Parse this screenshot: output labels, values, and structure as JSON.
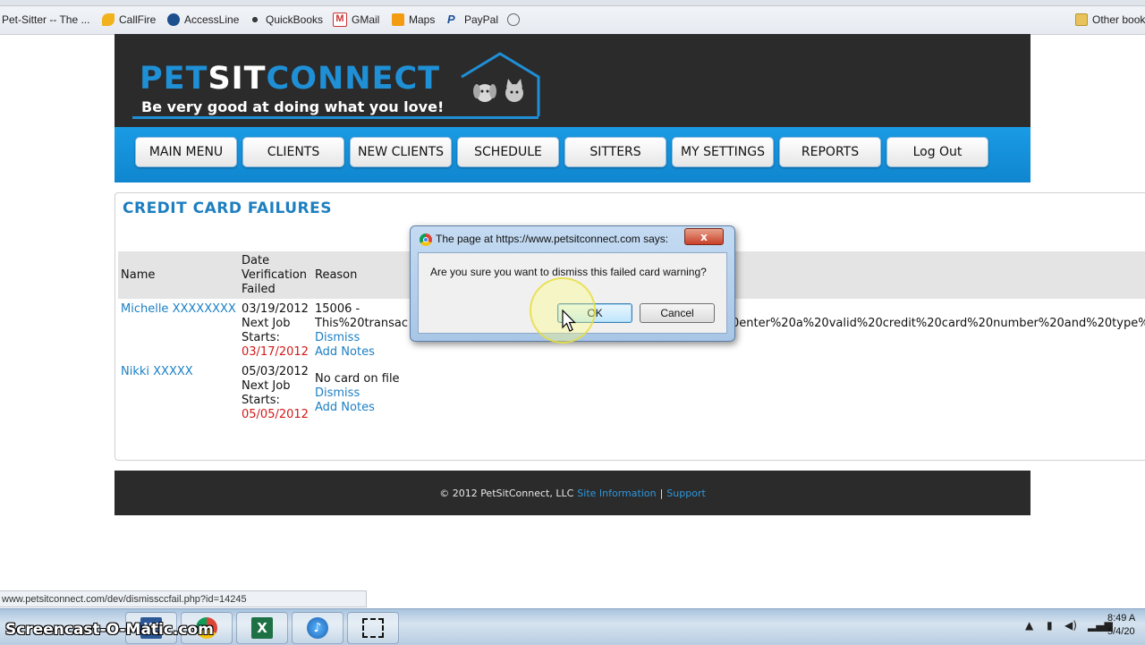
{
  "browser": {
    "bookmarks": [
      {
        "label": "Pet-Sitter -- The ...",
        "icon": "page-icon"
      },
      {
        "label": "CallFire",
        "icon": "callfire-icon"
      },
      {
        "label": "AccessLine",
        "icon": "accessline-icon"
      },
      {
        "label": "QuickBooks",
        "icon": "quickbooks-icon"
      },
      {
        "label": "GMail",
        "icon": "gmail-icon"
      },
      {
        "label": "Maps",
        "icon": "maps-icon"
      },
      {
        "label": "PayPal",
        "icon": "paypal-icon"
      },
      {
        "label": "",
        "icon": "globe-icon"
      }
    ],
    "other_bookmarks": "Other book",
    "status_url": "www.petsitconnect.com/dev/dismissccfail.php?id=14245"
  },
  "site": {
    "logo_pet": "PET",
    "logo_sit": "SIT",
    "logo_connect": "CONNECT",
    "tagline": "Be very good at doing what you love!",
    "nav": [
      "MAIN MENU",
      "CLIENTS",
      "NEW CLIENTS",
      "SCHEDULE",
      "SITTERS",
      "MY SETTINGS",
      "REPORTS",
      "Log Out"
    ],
    "brand_color": "#1f8fd6"
  },
  "page": {
    "title": "CREDIT CARD FAILURES",
    "columns": {
      "name": "Name",
      "date_line1": "Date",
      "date_line2": "Verification",
      "date_line3": "Failed",
      "reason": "Reason"
    },
    "rows": [
      {
        "name": "Michelle XXXXXXXX",
        "date": "03/19/2012",
        "next_job_label1": "Next Job",
        "next_job_label2": "Starts:",
        "next_job_date": "03/17/2012",
        "reason_line1": "15006 -",
        "reason_line2": "This%20transac",
        "reason_overflow": "0enter%20a%20valid%20credit%20card%20number%20and%20type%",
        "dismiss": "Dismiss",
        "add_notes": "Add Notes"
      },
      {
        "name": "Nikki XXXXX",
        "date": "05/03/2012",
        "next_job_label1": "Next Job",
        "next_job_label2": "Starts:",
        "next_job_date": "05/05/2012",
        "reason_line1": "No card on file",
        "dismiss": "Dismiss",
        "add_notes": "Add Notes"
      }
    ]
  },
  "footer": {
    "copyright": "© 2012 PetSitConnect, LLC",
    "site_info": "Site Information",
    "separator": "|",
    "support": "Support"
  },
  "dialog": {
    "title": "The page at https://www.petsitconnect.com says:",
    "message": "Are you sure you want to dismiss this failed card warning?",
    "ok": "OK",
    "cancel": "Cancel",
    "close": "x"
  },
  "taskbar": {
    "watermark": "Screencast-O-Matic.com",
    "time": "8:49 A",
    "date": "5/4/20"
  }
}
